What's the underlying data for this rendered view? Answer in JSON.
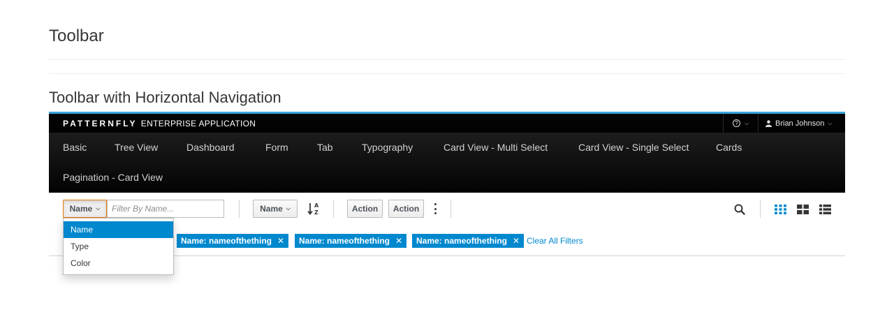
{
  "page": {
    "title": "Toolbar",
    "section_title": "Toolbar with Horizontal Navigation"
  },
  "masthead": {
    "brand_bold": "PATTERNFLY",
    "brand_rest": "ENTERPRISE APPLICATION",
    "help_icon": "question-circle-icon",
    "user_name": "Brian Johnson",
    "accent_color": "#39a5dc"
  },
  "nav": {
    "items": [
      "Basic",
      "Tree View",
      "Dashboard",
      "Form",
      "Tab",
      "Typography",
      "Card View - Multi Select",
      "Card View - Single Select",
      "Cards",
      "Pagination - Card View"
    ]
  },
  "toolbar": {
    "filter_field": "Name",
    "filter_placeholder": "Filter By Name...",
    "sort_field": "Name",
    "sort_icon": "sort-alpha-asc-icon",
    "action1": "Action",
    "action2": "Action",
    "kebab_icon": "kebab-icon",
    "search_icon": "search-icon",
    "view_icons": [
      "small-cards-view-icon",
      "large-cards-view-icon",
      "list-view-icon"
    ]
  },
  "filter_dropdown": {
    "options": [
      "Name",
      "Type",
      "Color"
    ],
    "selected": "Name"
  },
  "active_filters": {
    "chips": [
      "Name: nameofthething",
      "Name: nameofthething",
      "Name: nameofthething"
    ],
    "clear_all": "Clear All Filters"
  },
  "colors": {
    "primary": "#0088ce",
    "active_border": "#ec7a08"
  }
}
